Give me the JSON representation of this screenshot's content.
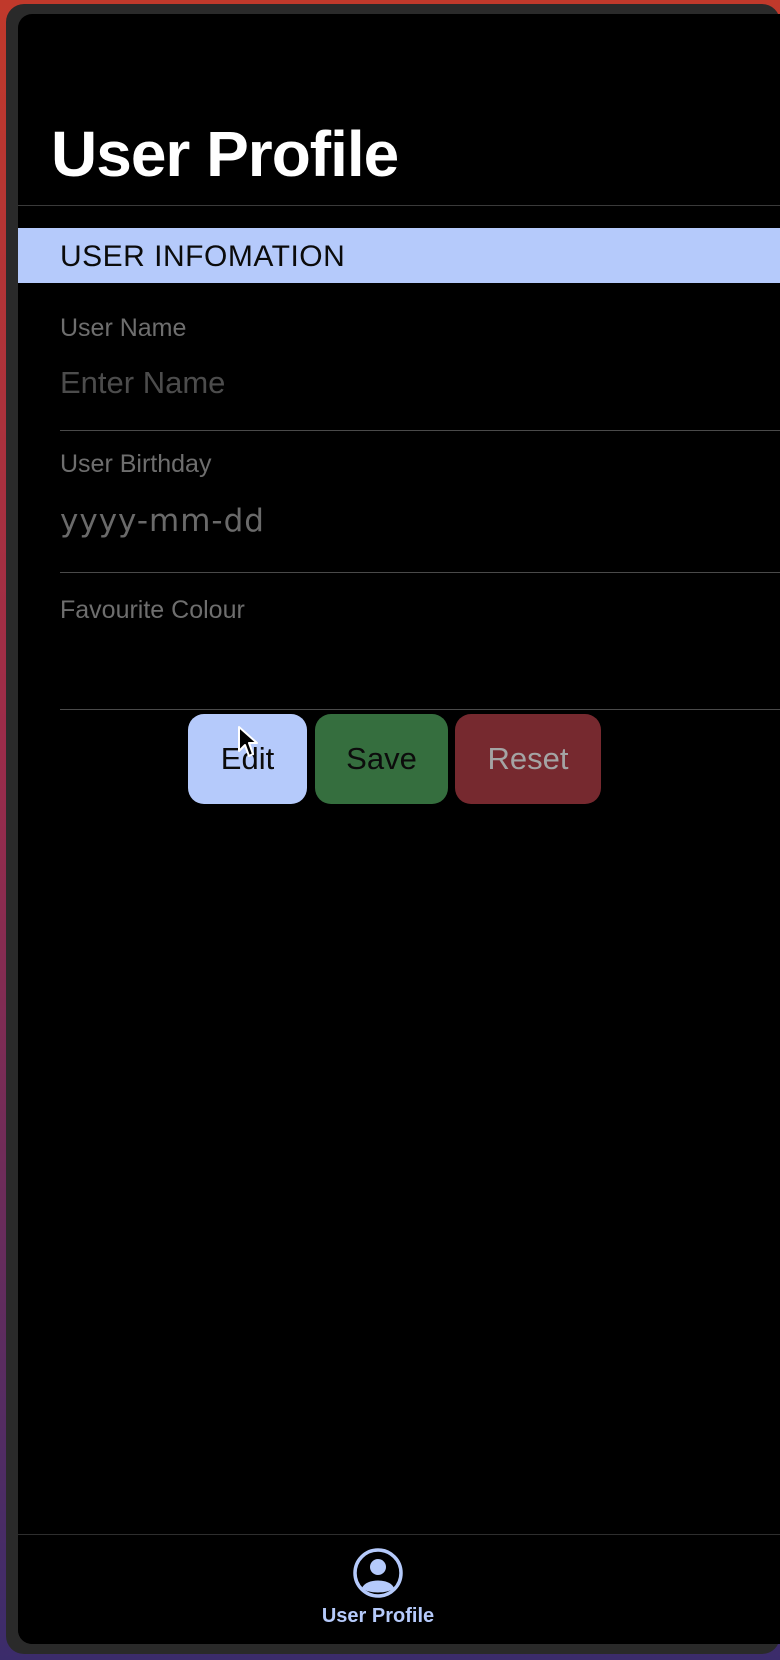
{
  "header": {
    "title": "User Profile"
  },
  "section": {
    "title": "USER INFOMATION"
  },
  "fields": {
    "name": {
      "label": "User Name",
      "value": "",
      "placeholder": "Enter Name"
    },
    "birthday": {
      "label": "User Birthday",
      "value": "",
      "placeholder": "yyyy-mm-dd"
    },
    "colour": {
      "label": "Favourite Colour",
      "value": ""
    }
  },
  "buttons": {
    "edit_label": "Edit",
    "save_label": "Save",
    "reset_label": "Reset"
  },
  "tab_bar": {
    "items": [
      {
        "label": "User Profile",
        "icon": "user-circle-icon",
        "active": true
      }
    ]
  },
  "colors": {
    "accent": "#b5cafb",
    "save": "#356e3e",
    "reset": "#76292f",
    "background": "#000000"
  }
}
